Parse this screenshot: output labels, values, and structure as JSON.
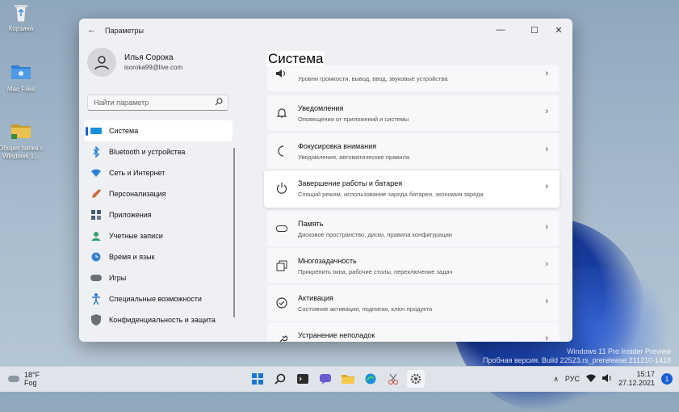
{
  "desktop": {
    "icons": [
      {
        "label": "Корзина",
        "icon": "recycle-bin-icon"
      },
      {
        "label": "Mac Files",
        "icon": "folder-icon"
      },
      {
        "label": "Общая папка с Windows 1...",
        "icon": "shared-folder-icon"
      }
    ],
    "watermark_line1": "Windows 11 Pro Insider Preview",
    "watermark_line2": "Пробная версия. Build 22523.rs_prerelease.211210-1418"
  },
  "window": {
    "title": "Параметры",
    "back_icon": "arrow-left-icon",
    "minimize": "—",
    "maximize": "☐",
    "close": "✕"
  },
  "profile": {
    "name": "Илья Сорока",
    "email": "isoroka99@live.com"
  },
  "search": {
    "placeholder": "Найти параметр"
  },
  "nav": [
    {
      "label": "Система",
      "icon": "monitor-icon",
      "color": "#1a90d9",
      "active": true
    },
    {
      "label": "Bluetooth и устройства",
      "icon": "bluetooth-icon",
      "color": "#2b7cd3"
    },
    {
      "label": "Сеть и Интернет",
      "icon": "wifi-icon",
      "color": "#2c7fd6"
    },
    {
      "label": "Персонализация",
      "icon": "brush-icon",
      "color": "#c86a3a"
    },
    {
      "label": "Приложения",
      "icon": "apps-icon",
      "color": "#4a5a70"
    },
    {
      "label": "Учетные записи",
      "icon": "user-icon",
      "color": "#3aa06b"
    },
    {
      "label": "Время и язык",
      "icon": "globe-clock-icon",
      "color": "#3b7fd0"
    },
    {
      "label": "Игры",
      "icon": "gamepad-icon",
      "color": "#6b6f78"
    },
    {
      "label": "Специальные возможности",
      "icon": "accessibility-icon",
      "color": "#2f7ad0"
    },
    {
      "label": "Конфиденциальность и защита",
      "icon": "shield-icon",
      "color": "#6b6f78"
    }
  ],
  "main": {
    "heading": "Система",
    "cards": [
      {
        "title": "",
        "subtitle": "Уровни громкости, вывод, ввод, звуковые устройства",
        "icon": "sound-icon"
      },
      {
        "title": "Уведомления",
        "subtitle": "Оповещения от приложений и системы",
        "icon": "bell-icon"
      },
      {
        "title": "Фокусировка внимания",
        "subtitle": "Уведомления, автоматические правила",
        "icon": "moon-icon"
      },
      {
        "title": "Завершение работы и батарея",
        "subtitle": "Спящий режим, использование заряда батареи, экономия заряда",
        "icon": "power-icon"
      },
      {
        "title": "Память",
        "subtitle": "Дисковое пространство, диски, правила конфигурации",
        "icon": "storage-icon"
      },
      {
        "title": "Многозадачность",
        "subtitle": "Прикрепить окна, рабочие столы, переключение задач",
        "icon": "multitask-icon"
      },
      {
        "title": "Активация",
        "subtitle": "Состояние активации, подписки, ключ продукта",
        "icon": "check-circle-icon"
      },
      {
        "title": "Устранение неполадок",
        "subtitle": "",
        "icon": "wrench-icon"
      }
    ]
  },
  "taskbar": {
    "weather_temp": "18°F",
    "weather_desc": "Fog",
    "language": "РУС",
    "time": "15:17",
    "date": "27.12.2021",
    "notifications": "1",
    "apps": [
      "windows-start-icon",
      "search-icon",
      "terminal-icon",
      "teams-chat-icon",
      "file-explorer-icon",
      "edge-icon",
      "snipping-tool-icon",
      "settings-icon"
    ]
  }
}
